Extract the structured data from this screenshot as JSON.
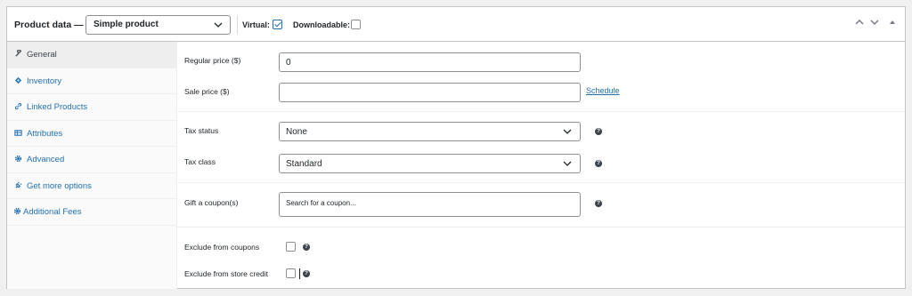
{
  "header": {
    "title": "Product data —",
    "product_type": "Simple product",
    "virtual_label": "Virtual:",
    "virtual_checked": true,
    "downloadable_label": "Downloadable:",
    "downloadable_checked": false
  },
  "tabs": [
    {
      "label": "General",
      "icon": "wrench-icon",
      "active": true
    },
    {
      "label": "Inventory",
      "icon": "tag-icon",
      "active": false
    },
    {
      "label": "Linked Products",
      "icon": "link-icon",
      "active": false
    },
    {
      "label": "Attributes",
      "icon": "table-icon",
      "active": false
    },
    {
      "label": "Advanced",
      "icon": "gear-icon",
      "active": false
    },
    {
      "label": "Get more options",
      "icon": "plugin-icon",
      "active": false
    },
    {
      "label": "Additional Fees",
      "icon": "gear-icon",
      "active": false
    }
  ],
  "general": {
    "regular_price_label": "Regular price ($)",
    "regular_price_value": "0",
    "sale_price_label": "Sale price ($)",
    "sale_price_value": "",
    "schedule_link": "Schedule",
    "tax_status_label": "Tax status",
    "tax_status_value": "None",
    "tax_class_label": "Tax class",
    "tax_class_value": "Standard",
    "gift_coupon_label": "Gift a coupon(s)",
    "gift_coupon_placeholder": "Search for a coupon...",
    "exclude_coupons_label": "Exclude from coupons",
    "exclude_credit_label": "Exclude from store credit"
  },
  "colors": {
    "accent": "#2271b1",
    "border": "#c3c4c7",
    "background": "#f0f0f1"
  }
}
